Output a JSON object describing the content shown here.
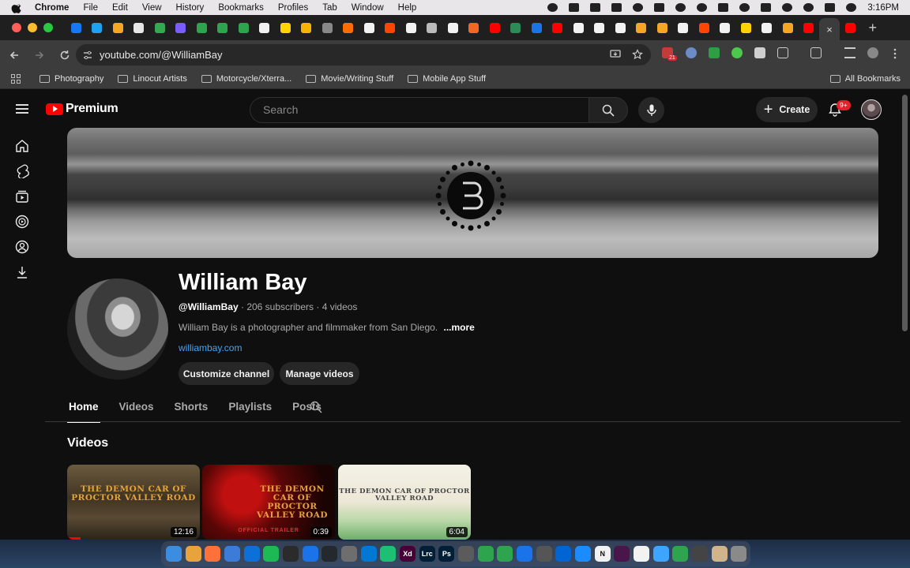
{
  "menubar": {
    "items": [
      "Chrome",
      "File",
      "Edit",
      "View",
      "History",
      "Bookmarks",
      "Profiles",
      "Tab",
      "Window",
      "Help"
    ],
    "clock": "3:16PM"
  },
  "browser": {
    "tab_favicon_colors": [
      "#1877f2",
      "#1da1f2",
      "#f5a623",
      "#e6e6e6",
      "#34a853",
      "#7b5cff",
      "#2ea44f",
      "#2ea44f",
      "#2ea44f",
      "#f2f2f2",
      "#ffd400",
      "#f4b400",
      "#888888",
      "#ff6d00",
      "#f2f2f2",
      "#ff4500",
      "#f2f2f2",
      "#bbbbbb",
      "#f2f2f2",
      "#f26722",
      "#ff0000",
      "#2e8b57",
      "#1a73e8",
      "#ff0000",
      "#f2f2f2",
      "#f2f2f2",
      "#f2f2f2",
      "#f5a623",
      "#f5a623",
      "#f2f2f2",
      "#ff4500",
      "#f2f2f2",
      "#ffd400",
      "#f2f2f2",
      "#f5a623",
      "#ff0000"
    ],
    "active_tab_close": "×",
    "new_tab": "+",
    "url": "youtube.com/@WilliamBay",
    "calendar_badge": "21"
  },
  "bookmarks": {
    "items": [
      "Photography",
      "Linocut Artists",
      "Motorcycle/Xterra...",
      "Movie/Writing Stuff",
      "Mobile App Stuff"
    ],
    "all": "All Bookmarks"
  },
  "youtube": {
    "brand": "Premium",
    "search_placeholder": "Search",
    "create_label": "Create",
    "notification_count": "9+",
    "channel": {
      "name": "William Bay",
      "handle": "@WilliamBay",
      "subscribers": "206 subscribers",
      "videos_count": "4 videos",
      "description": "William Bay is a photographer and filmmaker from San Diego.",
      "more": "...more",
      "link": "williambay.com",
      "customize_label": "Customize channel",
      "manage_label": "Manage videos"
    },
    "tabs": [
      "Home",
      "Videos",
      "Shorts",
      "Playlists",
      "Posts"
    ],
    "section_title": "Videos",
    "videos": [
      {
        "title_art": "THE DEMON CAR OF PROCTOR VALLEY ROAD",
        "duration": "12:16",
        "progress": 0.1
      },
      {
        "title_art": "THE DEMON CAR OF PROCTOR VALLEY ROAD",
        "subtitle": "OFFICIAL TRAILER",
        "duration": "0:39",
        "progress": 0
      },
      {
        "title_art": "THE DEMON CAR OF PROCTOR VALLEY ROAD",
        "duration": "6:04",
        "progress": 0
      }
    ]
  },
  "dock": {
    "icon_labels": [
      "",
      "",
      "",
      "",
      "",
      "",
      "",
      "",
      "",
      "",
      "",
      "",
      "Xd",
      "Lrc",
      "Ps",
      "",
      "",
      "",
      "",
      "",
      "",
      "",
      "N",
      "",
      "",
      "",
      "",
      "",
      "",
      ""
    ],
    "icon_colors": [
      "#3b8de0",
      "#e8a33d",
      "#ff7139",
      "#3d7bd9",
      "#0d6fd8",
      "#1db954",
      "#2b2b2b",
      "#1a73e8",
      "#24292e",
      "#6e6e6e",
      "#0078d4",
      "#1dbf73",
      "#470137",
      "#001e36",
      "#001e36",
      "#5b5b5b",
      "#2ea44f",
      "#2ea44f",
      "#1a73e8",
      "#555555",
      "#0064d2",
      "#1a8cff",
      "#f2f2f2",
      "#4a154b",
      "#f2f2f2",
      "#3da5ff",
      "#2ea44f",
      "#444444",
      "#d2b48c",
      "#8a8a8a"
    ]
  },
  "colors": {
    "accent": "#ff0000",
    "link": "#3ea6ff",
    "badge": "#e5202a"
  }
}
